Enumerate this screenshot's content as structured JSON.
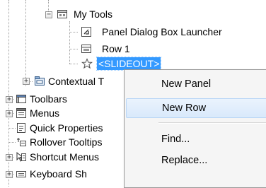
{
  "tree": {
    "my_tools": "My Tools",
    "panel_dialog_box_launcher": "Panel Dialog Box Launcher",
    "row_1": "Row 1",
    "slideout": "<SLIDEOUT>",
    "contextual_tabs": "Contextual T",
    "toolbars": "Toolbars",
    "menus": "Menus",
    "quick_properties": "Quick Properties",
    "rollover_tooltips": "Rollover Tooltips",
    "shortcut_menus": "Shortcut Menus",
    "keyboard_shortcuts": "Keyboard Sh"
  },
  "context_menu": {
    "items": [
      "New Panel",
      "New Row",
      "Find...",
      "Replace..."
    ]
  },
  "colors": {
    "selection": "#3399ff",
    "menu_bg": "#f5f5f5",
    "hover": "#d9e9fb"
  }
}
